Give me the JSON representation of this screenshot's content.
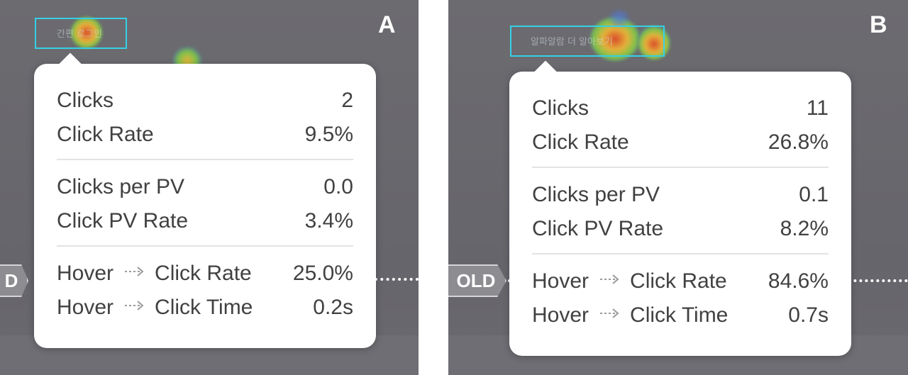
{
  "panels": [
    {
      "label": "A",
      "target_text": "간편 로그인",
      "fold_label": "D",
      "stats": {
        "clicks_label": "Clicks",
        "clicks_value": "2",
        "click_rate_label": "Click Rate",
        "click_rate_value": "9.5%",
        "clicks_per_pv_label": "Clicks per PV",
        "clicks_per_pv_value": "0.0",
        "click_pv_rate_label": "Click PV Rate",
        "click_pv_rate_value": "3.4%",
        "hover_label": "Hover",
        "hover_click_rate_label": "Click Rate",
        "hover_click_rate_value": "25.0%",
        "hover_click_time_label": "Click Time",
        "hover_click_time_value": "0.2s"
      }
    },
    {
      "label": "B",
      "target_text": "알파알람 더 알아보기",
      "fold_label": "OLD",
      "stats": {
        "clicks_label": "Clicks",
        "clicks_value": "11",
        "click_rate_label": "Click Rate",
        "click_rate_value": "26.8%",
        "clicks_per_pv_label": "Clicks per PV",
        "clicks_per_pv_value": "0.1",
        "click_pv_rate_label": "Click PV Rate",
        "click_pv_rate_value": "8.2%",
        "hover_label": "Hover",
        "hover_click_rate_label": "Click Rate",
        "hover_click_rate_value": "84.6%",
        "hover_click_time_label": "Click Time",
        "hover_click_time_value": "0.7s"
      }
    }
  ],
  "icons": {
    "arrow": "dashed-arrow-right-icon"
  },
  "colors": {
    "highlight_box": "#35d0e6",
    "tooltip_bg": "#ffffff",
    "background": "#6c6b70"
  }
}
